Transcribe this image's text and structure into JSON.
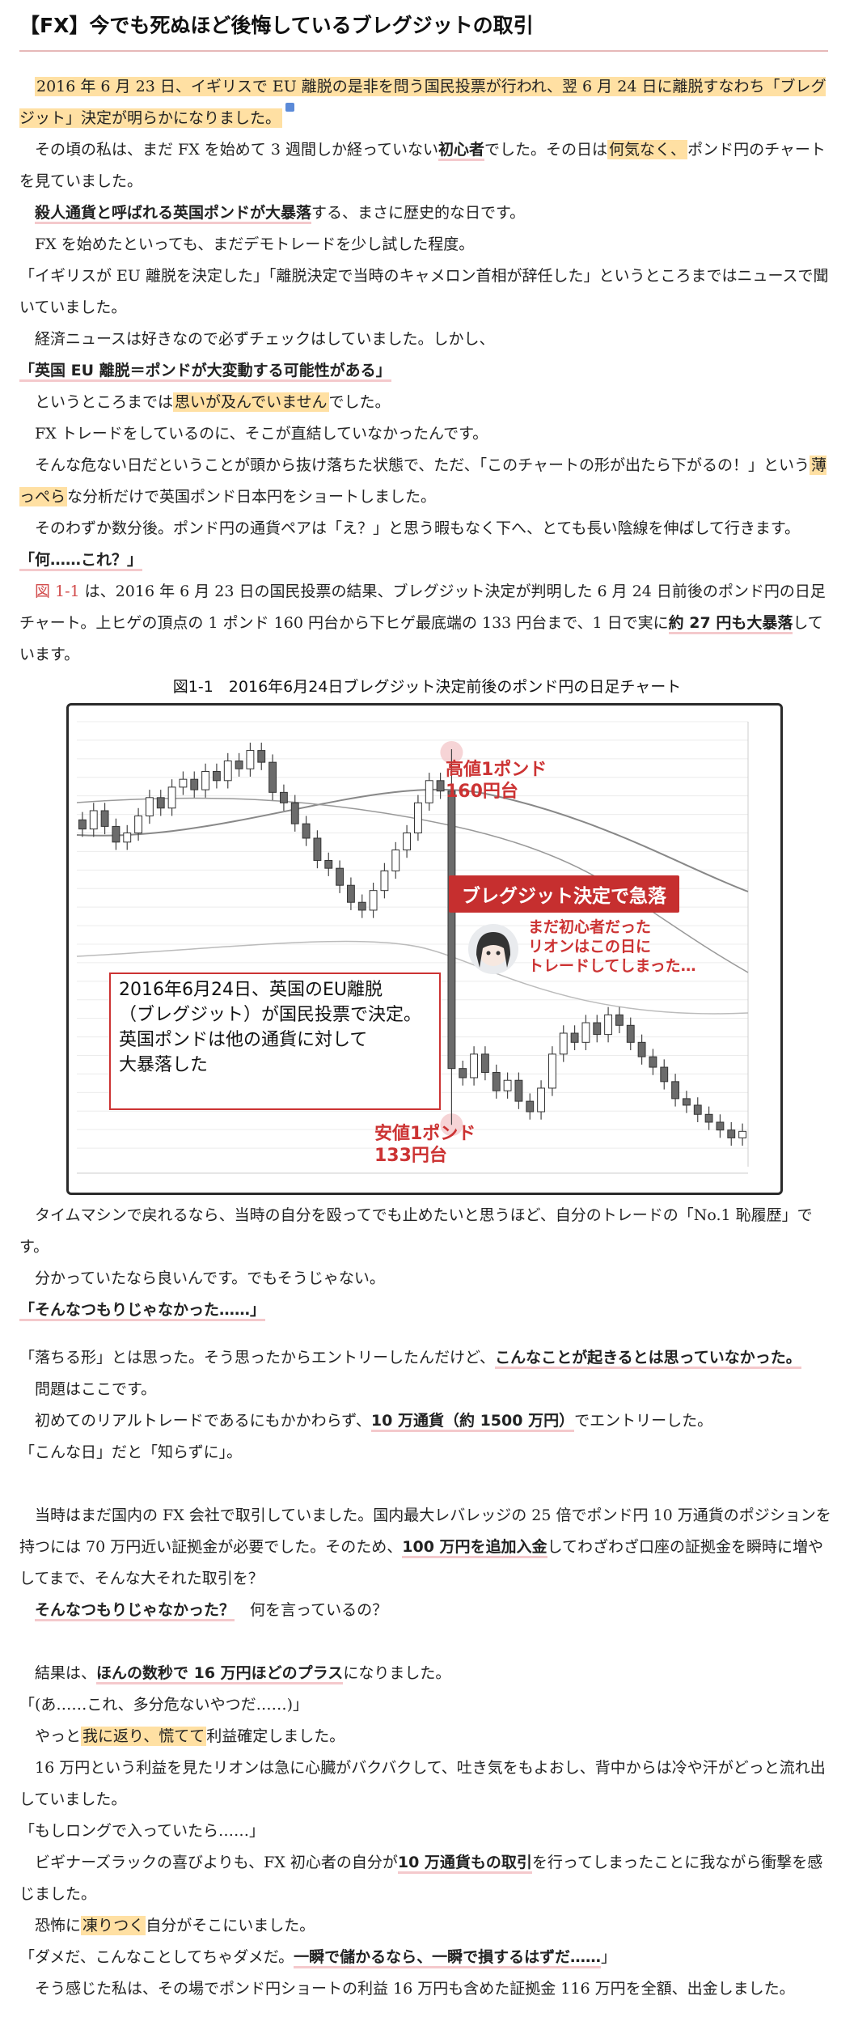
{
  "title": "【FX】今でも死ぬほど後悔しているブレグジットの取引",
  "paragraphs": {
    "p1": "2016 年 6 月 23 日、イギリスで EU 離脱の是非を問う国民投票が行われ、翌 6 月 24 日に離脱すなわち「ブレグジット」決定が明らかになりました。",
    "p2a": "その頃の私は、まだ FX を始めて 3 週間しか経っていない",
    "p2b": "初心者",
    "p2c": "でした。その日は",
    "p2d": "何気なく、",
    "p2e": "ポンド円のチャートを見ていました。",
    "p3a": "殺人通貨と呼ばれる英国ポンドが大暴落",
    "p3b": "する、まさに歴史的な日です。",
    "p4": "FX を始めたといっても、まだデモトレードを少し試した程度。",
    "p5": "「イギリスが EU 離脱を決定した」「離脱決定で当時のキャメロン首相が辞任した」というところまではニュースで聞いていました。",
    "p6": "経済ニュースは好きなので必ずチェックはしていました。しかし、",
    "p7": "「英国 EU 離脱＝ポンドが大変動する可能性がある」",
    "p8a": "というところまでは",
    "p8b": "思いが及んでいません",
    "p8c": "でした。",
    "p9": "FX トレードをしているのに、そこが直結していなかったんです。",
    "p10a": "そんな危ない日だということが頭から抜け落ちた状態で、ただ、「このチャートの形が出たら下がるの！」という",
    "p10b": "薄っぺら",
    "p10c": "な分析だけで英国ポンド日本円をショートしました。",
    "p11": "そのわずか数分後。ポンド円の通貨ペアは「え？」と思う暇もなく下へ、とても長い陰線を伸ばして行きます。",
    "p12": "「何……これ？」",
    "p13a": "図 1-1",
    "p13b": " は、2016 年 6 月 23 日の国民投票の結果、ブレグジット決定が判明した 6 月 24 日前後のポンド円の日足チャート。上ヒゲの頂点の 1 ポンド 160 円台から下ヒゲ最底端の 133 円台まで、1 日で実に",
    "p13c": "約 27 円も大暴落",
    "p13d": "しています。",
    "p14": "タイムマシンで戻れるなら、当時の自分を殴ってでも止めたいと思うほど、自分のトレードの「No.1 恥履歴」です。",
    "p15": "分かっていたなら良いんです。でもそうじゃない。",
    "p16": "「そんなつもりじゃなかった……」",
    "p17a": "「落ちる形」とは思った。そう思ったからエントリーしたんだけど、",
    "p17b": "こんなことが起きるとは思っていなかった。",
    "p18": "問題はここです。",
    "p19a": "初めてのリアルトレードであるにもかかわらず、",
    "p19b": "10 万通貨（約 1500 万円）",
    "p19c": "でエントリーした。",
    "p20": "「こんな日」だと「知らずに」。",
    "p21a": "当時はまだ国内の FX 会社で取引していました。国内最大レバレッジの 25 倍でポンド円 10 万通貨のポジションを持つには 70 万円近い証拠金が必要でした。そのため、",
    "p21b": "100 万円を追加入金",
    "p21c": "してわざわざ口座の証拠金を瞬時に増やしてまで、そんな大それた取引を？",
    "p22a": "そんなつもりじゃなかった？",
    "p22b": "　何を言っているの？",
    "p23a": "結果は、",
    "p23b": "ほんの数秒で 16 万円ほどのプラス",
    "p23c": "になりました。",
    "p24": "「(あ……これ、多分危ないやつだ……)」",
    "p25a": "やっと",
    "p25b": "我に返り、慌てて",
    "p25c": "利益確定しました。",
    "p26": "16 万円という利益を見たリオンは急に心臓がバクバクして、吐き気をもよおし、背中からは冷や汗がどっと流れ出していました。",
    "p27": "「もしロングで入っていたら……」",
    "p28a": "ビギナーズラックの喜びよりも、FX 初心者の自分が",
    "p28b": "10 万通貨もの取引",
    "p28c": "を行ってしまったことに我ながら衝撃を感じました。",
    "p29a": "恐怖に",
    "p29b": "凍りつく",
    "p29c": "自分がそこにいました。",
    "p30a": "「ダメだ、こんなことしてちゃダメだ。",
    "p30b": "一瞬で儲かるなら、一瞬で損するはずだ……",
    "p30c": "」",
    "p31": "そう感じた私は、その場でポンド円ショートの利益 16 万円も含めた証拠金 116 万円を全額、出金しました。"
  },
  "figure": {
    "caption": "図1-1　2016年6月24日ブレグジット決定前後のポンド円の日足チャート",
    "high_label_1": "高値1ポンド",
    "high_label_2": "160円台",
    "low_label_1": "安値1ポンド",
    "low_label_2": "133円台",
    "banner": "ブレグジット決定で急落",
    "avatar_note_1": "まだ初心者だった",
    "avatar_note_2": "リオンはこの日に",
    "avatar_note_3": "トレードしてしまった…",
    "box_1": "2016年6月24日、英国のEU離脱",
    "box_2": "（ブレグジット）が国民投票で決定。",
    "box_3": "英国ポンドは他の通貨に対して",
    "box_4": "大暴落した"
  },
  "chart_data": {
    "type": "candlestick",
    "title": "図1-1　2016年6月24日ブレグジット決定前後のポンド円の日足チャート",
    "series": [
      {
        "open": [
          156.5,
          155.8,
          157.2,
          156.0,
          154.8,
          155.5,
          156.8,
          158.2,
          157.4,
          159.0,
          159.6,
          158.8,
          160.2,
          159.5,
          161.0,
          160.4,
          161.8,
          160.9,
          158.6,
          157.8,
          156.2,
          155.1,
          153.4,
          152.8,
          151.5,
          150.2,
          149.6,
          151.1,
          152.6,
          154.2,
          155.5,
          157.8,
          159.5,
          158.7,
          137.5,
          136.8,
          138.6,
          137.2,
          135.8,
          136.6,
          135.0,
          134.2,
          136.0,
          138.6,
          140.2,
          139.5,
          141.0,
          140.1,
          141.6,
          140.8,
          139.5,
          138.4,
          137.6,
          136.5,
          135.2,
          134.7,
          134.0,
          133.4,
          132.8,
          132.2
        ]
      },
      {
        "close": [
          155.8,
          157.2,
          156.0,
          154.8,
          155.5,
          156.8,
          158.2,
          157.4,
          159.0,
          159.6,
          158.8,
          160.2,
          159.5,
          161.0,
          160.4,
          161.8,
          160.9,
          158.6,
          157.8,
          156.2,
          155.1,
          153.4,
          152.8,
          151.5,
          150.2,
          149.6,
          151.1,
          152.6,
          154.2,
          155.5,
          157.8,
          159.5,
          158.7,
          137.5,
          136.8,
          138.6,
          137.2,
          135.8,
          136.6,
          135.0,
          134.2,
          136.0,
          138.6,
          140.2,
          139.5,
          141.0,
          140.1,
          141.6,
          140.8,
          139.5,
          138.4,
          137.6,
          136.5,
          135.2,
          134.7,
          134.0,
          133.4,
          132.8,
          132.2,
          132.7
        ]
      }
    ],
    "annotations": [
      "高値1ポンド 160円台",
      "安値1ポンド 133円台",
      "ブレグジット決定で急落"
    ]
  }
}
